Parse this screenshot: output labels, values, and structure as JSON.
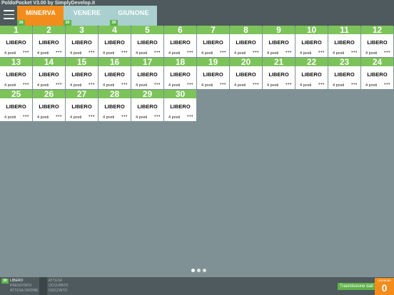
{
  "app": {
    "title": "PoldoPocket V3.00 by SimplyDevelop.it"
  },
  "tabs": [
    {
      "label": "MINERVA",
      "count": "30",
      "active": true
    },
    {
      "label": "VENERE",
      "count": "30",
      "active": false
    },
    {
      "label": "GIUNONE",
      "count": "30",
      "active": false
    }
  ],
  "tables": [
    {
      "number": "1",
      "status": "LIBERO",
      "seats": "4 posti"
    },
    {
      "number": "2",
      "status": "LIBERO",
      "seats": "4 posti"
    },
    {
      "number": "3",
      "status": "LIBERO",
      "seats": "4 posti"
    },
    {
      "number": "4",
      "status": "LIBERO",
      "seats": "4 posti"
    },
    {
      "number": "5",
      "status": "LIBERO",
      "seats": "4 posti"
    },
    {
      "number": "6",
      "status": "LIBERO",
      "seats": "4 posti"
    },
    {
      "number": "7",
      "status": "LIBERO",
      "seats": "4 posti"
    },
    {
      "number": "8",
      "status": "LIBERO",
      "seats": "4 posti"
    },
    {
      "number": "9",
      "status": "LIBERO",
      "seats": "4 posti"
    },
    {
      "number": "10",
      "status": "LIBERO",
      "seats": "4 posti"
    },
    {
      "number": "11",
      "status": "LIBERO",
      "seats": "4 posti"
    },
    {
      "number": "12",
      "status": "LIBERO",
      "seats": "4 posti"
    },
    {
      "number": "13",
      "status": "LIBERO",
      "seats": "4 posti"
    },
    {
      "number": "14",
      "status": "LIBERO",
      "seats": "4 posti"
    },
    {
      "number": "15",
      "status": "LIBERO",
      "seats": "4 posti"
    },
    {
      "number": "16",
      "status": "LIBERO",
      "seats": "4 posti"
    },
    {
      "number": "17",
      "status": "LIBERO",
      "seats": "4 posti"
    },
    {
      "number": "18",
      "status": "LIBERO",
      "seats": "4 posti"
    },
    {
      "number": "19",
      "status": "LIBERO",
      "seats": "4 posti"
    },
    {
      "number": "20",
      "status": "LIBERO",
      "seats": "4 posti"
    },
    {
      "number": "21",
      "status": "LIBERO",
      "seats": "4 posti"
    },
    {
      "number": "22",
      "status": "LIBERO",
      "seats": "4 posti"
    },
    {
      "number": "23",
      "status": "LIBERO",
      "seats": "4 posti"
    },
    {
      "number": "24",
      "status": "LIBERO",
      "seats": "4 posti"
    },
    {
      "number": "25",
      "status": "LIBERO",
      "seats": "4 posti"
    },
    {
      "number": "26",
      "status": "LIBERO",
      "seats": "4 posti"
    },
    {
      "number": "27",
      "status": "LIBERO",
      "seats": "4 posti"
    },
    {
      "number": "28",
      "status": "LIBERO",
      "seats": "4 posti"
    },
    {
      "number": "29",
      "status": "LIBERO",
      "seats": "4 posti"
    },
    {
      "number": "30",
      "status": "LIBERO",
      "seats": "4 posti"
    }
  ],
  "table_menu_glyph": "•••",
  "pager": {
    "pages": 3,
    "current": 1
  },
  "legend": {
    "free_count": "30",
    "free_label": "LIBERO",
    "booked_label": "PRENOTATO",
    "ordering_label": "ATTESA ORDINE",
    "waiting_label": "ATTESA",
    "occupied_label": "OCCUPATO",
    "checkout_label": "DISCONTO"
  },
  "bottom": {
    "transmission_label": "Trasmissione dati",
    "counter_label": "comande",
    "counter_value": "0"
  },
  "colors": {
    "active_tab": "#f28c1b",
    "inactive_tab": "#a9cfcf",
    "table_header": "#7cc35a",
    "bar": "#4e5a5d",
    "background": "#7f9195"
  }
}
